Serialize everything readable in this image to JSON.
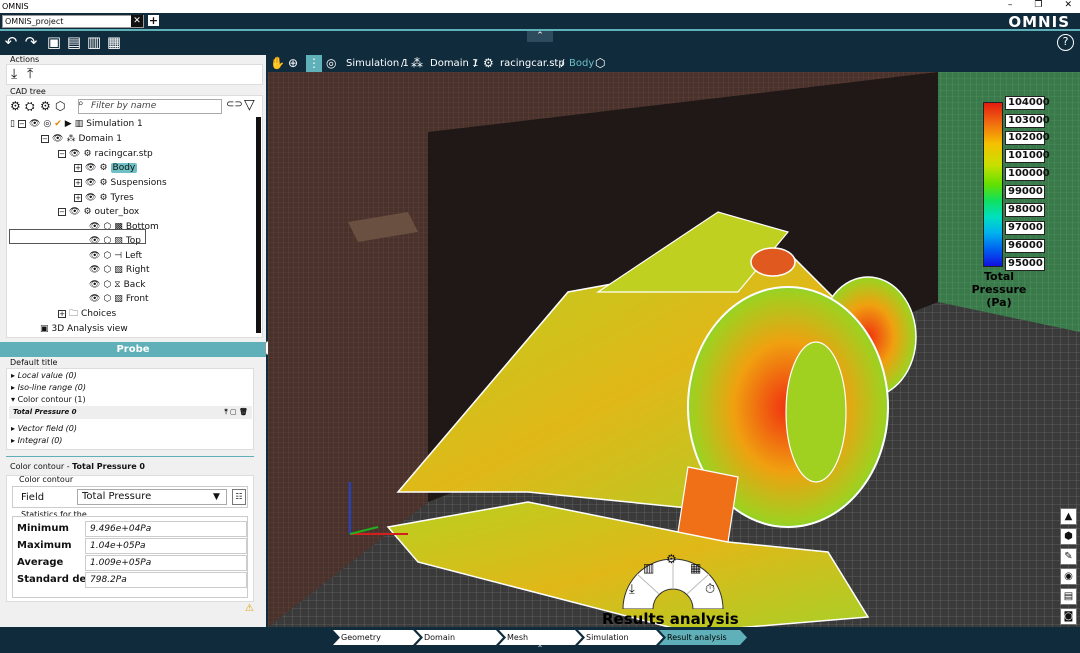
{
  "app": {
    "title": "OMNIS",
    "brand": "OMNIS",
    "project_tab": "OMNIS_project"
  },
  "toolbar": {
    "help": "?"
  },
  "left": {
    "actions_label": "Actions",
    "cad_label": "CAD tree",
    "filter_placeholder": "Filter by name",
    "tree": [
      {
        "label": "Simulation 1"
      },
      {
        "label": "Domain 1"
      },
      {
        "label": "racingcar.stp"
      },
      {
        "label": "Body"
      },
      {
        "label": "Suspensions"
      },
      {
        "label": "Tyres"
      },
      {
        "label": "outer_box"
      },
      {
        "label": "Bottom"
      },
      {
        "label": "Top"
      },
      {
        "label": "Left"
      },
      {
        "label": "Right"
      },
      {
        "label": "Back"
      },
      {
        "label": "Front"
      },
      {
        "label": "Choices"
      },
      {
        "label": "3D Analysis view"
      }
    ]
  },
  "probe": {
    "title": "Probe",
    "default_title": "Default title",
    "items": [
      "Local value (0)",
      "Iso-line range (0)",
      "Color contour (1)",
      "Vector field (0)",
      "Integral (0)"
    ],
    "row": "Total Pressure 0"
  },
  "contour": {
    "title_prefix": "Color contour - ",
    "title_bold": "Total Pressure 0",
    "section": "Color contour",
    "field_label": "Field",
    "field_value": "Total Pressure",
    "stats_label": "Statistics for the",
    "stats": [
      {
        "name": "Minimum",
        "value": "9.496e+04Pa"
      },
      {
        "name": "Maximum",
        "value": "1.04e+05Pa"
      },
      {
        "name": "Average",
        "value": "1.009e+05Pa"
      },
      {
        "name": "Standard dev",
        "value": "798.2Pa"
      }
    ]
  },
  "viewport": {
    "breadcrumb": [
      "Simulation 1",
      "Domain 1",
      "racingcar.stp",
      "Body"
    ],
    "legend_labels": [
      "104000",
      "103000",
      "102000",
      "101000",
      "100000",
      "99000",
      "98000",
      "97000",
      "96000",
      "95000"
    ],
    "legend_title": "Total Pressure (Pa)",
    "radial_label": "Results analysis"
  },
  "steps": [
    "Geometry",
    "Domain",
    "Mesh",
    "Simulation",
    "Result analysis"
  ]
}
